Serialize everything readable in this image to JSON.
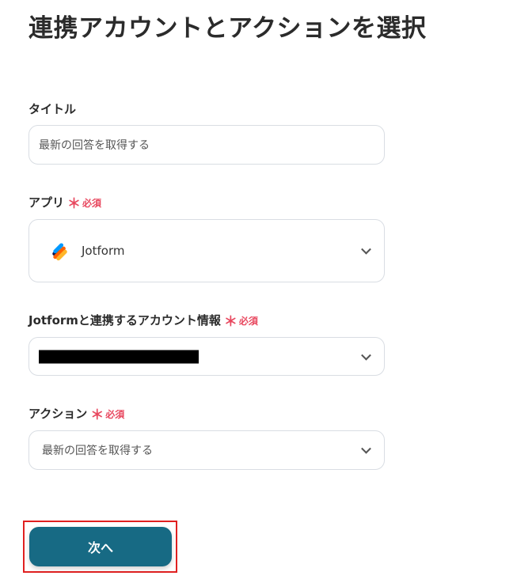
{
  "page": {
    "title": "連携アカウントとアクションを選択"
  },
  "form": {
    "title_field": {
      "label": "タイトル",
      "value": "最新の回答を取得する"
    },
    "app_field": {
      "label": "アプリ",
      "required_mark": "＊",
      "required_text": "必須",
      "value": "Jotform",
      "icon": "jotform-logo-icon"
    },
    "account_field": {
      "label": "Jotformと連携するアカウント情報",
      "required_mark": "＊",
      "required_text": "必須",
      "value_redacted": true
    },
    "action_field": {
      "label": "アクション",
      "required_mark": "＊",
      "required_text": "必須",
      "value": "最新の回答を取得する"
    }
  },
  "actions": {
    "next_label": "次へ"
  },
  "colors": {
    "primary": "#176a84",
    "required": "#e8485f",
    "highlight_border": "#e02020",
    "jotform_orange": "#ff6100",
    "jotform_yellow": "#ffb629",
    "jotform_blue": "#0099ff",
    "jotform_navy": "#0a1551"
  }
}
